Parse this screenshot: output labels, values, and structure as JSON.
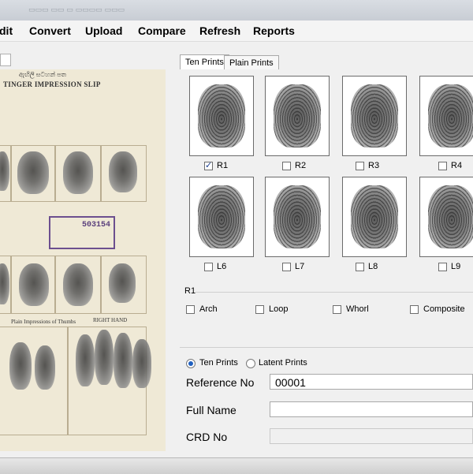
{
  "menu": {
    "items": [
      "dit",
      "Convert",
      "Upload",
      "Compare",
      "Refresh",
      "Reports"
    ]
  },
  "document": {
    "header_line": "ඇඟිලි සටහන් පත",
    "slip_title": "TINGER IMPRESSION SLIP",
    "stamp_number": "503154",
    "sections": {
      "right_hand": "RIGHT HAND",
      "plain_thumbs": "Plain Impressions of Thumbs"
    }
  },
  "tabs": [
    {
      "label": "Ten Prints",
      "active": true
    },
    {
      "label": "Plain Prints",
      "active": false
    }
  ],
  "prints": [
    {
      "label": "R1",
      "checked": true
    },
    {
      "label": "R2",
      "checked": false
    },
    {
      "label": "R3",
      "checked": false
    },
    {
      "label": "R4",
      "checked": false
    },
    {
      "label": "L6",
      "checked": false
    },
    {
      "label": "L7",
      "checked": false
    },
    {
      "label": "L8",
      "checked": false
    },
    {
      "label": "L9",
      "checked": false
    }
  ],
  "classification": {
    "title": "R1",
    "options": [
      "Arch",
      "Loop",
      "Whorl",
      "Composite"
    ]
  },
  "search": {
    "mode_options": [
      {
        "label": "Ten Prints",
        "selected": true
      },
      {
        "label": "Latent Prints",
        "selected": false
      }
    ],
    "fields": [
      {
        "label": "Reference No",
        "value": "00001",
        "enabled": true
      },
      {
        "label": "Full Name",
        "value": "",
        "enabled": true
      },
      {
        "label": "CRD No",
        "value": "",
        "enabled": false
      }
    ]
  }
}
